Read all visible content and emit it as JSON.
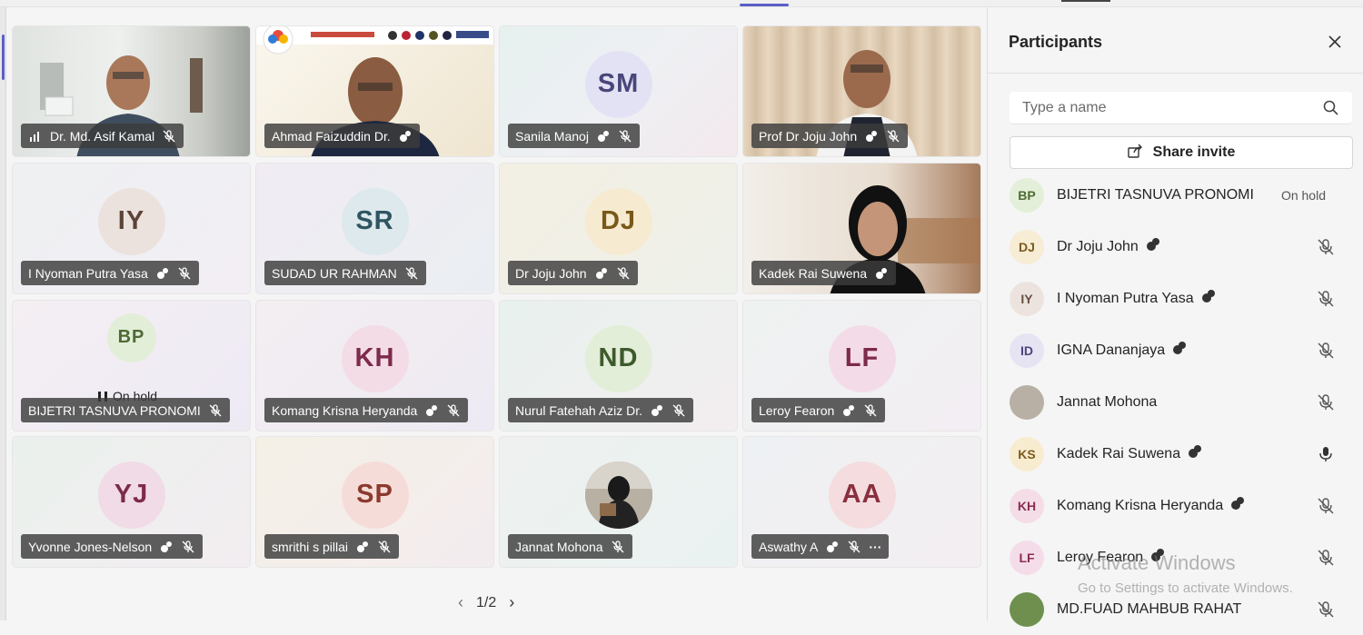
{
  "grid": {
    "tiles": [
      {
        "name": "Dr. Md. Asif Kamal",
        "initials": "",
        "kind": "video"
      },
      {
        "name": "Ahmad Faizuddin Dr.",
        "initials": "",
        "kind": "video"
      },
      {
        "name": "Sanila Manoj",
        "initials": "SM",
        "kind": "avatar"
      },
      {
        "name": "Prof Dr Joju John",
        "initials": "",
        "kind": "video"
      },
      {
        "name": "I Nyoman Putra Yasa",
        "initials": "IY",
        "kind": "avatar"
      },
      {
        "name": "SUDAD UR RAHMAN",
        "initials": "SR",
        "kind": "avatar"
      },
      {
        "name": "Dr Joju John",
        "initials": "DJ",
        "kind": "avatar"
      },
      {
        "name": "Kadek Rai Suwena",
        "initials": "",
        "kind": "video"
      },
      {
        "name": "BIJETRI TASNUVA PRONOMI",
        "initials": "BP",
        "kind": "avatar",
        "hold": "On hold"
      },
      {
        "name": "Komang Krisna Heryanda",
        "initials": "KH",
        "kind": "avatar"
      },
      {
        "name": "Nurul Fatehah Aziz Dr.",
        "initials": "ND",
        "kind": "avatar"
      },
      {
        "name": "Leroy Fearon",
        "initials": "LF",
        "kind": "avatar"
      },
      {
        "name": "Yvonne Jones-Nelson",
        "initials": "YJ",
        "kind": "avatar"
      },
      {
        "name": "smrithi s pillai",
        "initials": "SP",
        "kind": "avatar"
      },
      {
        "name": "Jannat Mohona",
        "initials": "",
        "kind": "photo"
      },
      {
        "name": "Aswathy A",
        "initials": "AA",
        "kind": "avatar",
        "more": "···"
      }
    ],
    "pager": {
      "label": "1/2",
      "prev": "‹",
      "next": "›"
    }
  },
  "panel": {
    "title": "Participants",
    "search_placeholder": "Type a name",
    "share_invite": "Share invite",
    "participants": [
      {
        "initials": "BP",
        "name": "BIJETRI TASNUVA PRONOMI",
        "status": "On hold",
        "bg": "#e3efd8",
        "fg": "#4d6b33"
      },
      {
        "initials": "DJ",
        "name": "Dr Joju John",
        "status": "",
        "bg": "#f7ecd4",
        "fg": "#7a5a1e"
      },
      {
        "initials": "IY",
        "name": "I Nyoman Putra Yasa",
        "status": "",
        "bg": "#ece3df",
        "fg": "#6a4e43"
      },
      {
        "initials": "ID",
        "name": "IGNA Dananjaya",
        "status": "",
        "bg": "#e6e4f2",
        "fg": "#4b4680"
      },
      {
        "initials": "",
        "name": "Jannat Mohona",
        "status": "",
        "bg": "#b8b0a4",
        "fg": "#333"
      },
      {
        "initials": "KS",
        "name": "Kadek Rai Suwena",
        "status": "",
        "bg": "#f8ecd0",
        "fg": "#7a5a1e"
      },
      {
        "initials": "KH",
        "name": "Komang Krisna Heryanda",
        "status": "",
        "bg": "#f4dde6",
        "fg": "#8a2f54"
      },
      {
        "initials": "LF",
        "name": "Leroy Fearon",
        "status": "",
        "bg": "#f4dde8",
        "fg": "#8a2f54"
      },
      {
        "initials": "",
        "name": "MD.FUAD MAHBUB RAHAT",
        "status": "",
        "bg": "#6e8f4e",
        "fg": "#fff"
      }
    ]
  },
  "watermark": {
    "line1": "Activate Windows",
    "line2": "Go to Settings to activate Windows."
  }
}
